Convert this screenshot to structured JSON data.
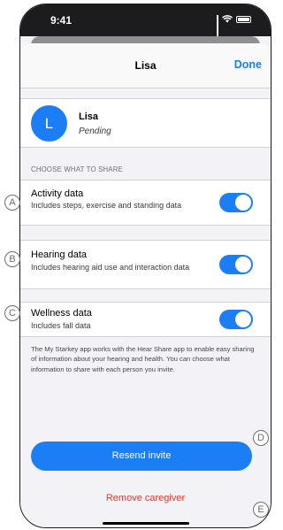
{
  "status_bar": {
    "time": "9:41",
    "icons": [
      "cellular-icon",
      "wifi-icon",
      "battery-icon"
    ]
  },
  "nav": {
    "title": "Lisa",
    "done_label": "Done"
  },
  "contact": {
    "initial": "L",
    "name": "Lisa",
    "status": "Pending"
  },
  "section_header": "CHOOSE WHAT TO SHARE",
  "share_options": [
    {
      "marker": "A",
      "title": "Activity data",
      "description": "Includes steps, exercise and standing data",
      "enabled": true
    },
    {
      "marker": "B",
      "title": "Hearing data",
      "description": "Includes hearing aid use and interaction data",
      "enabled": true
    },
    {
      "marker": "C",
      "title": "Wellness data",
      "description": "Includes fall data",
      "enabled": true
    }
  ],
  "footer_text": "The My Starkey app works with the Hear Share app to enable easy sharing of information about your hearing and health. You can choose what information to share with each person you invite.",
  "actions": {
    "resend_label": "Resend invite",
    "resend_marker": "D",
    "remove_label": "Remove caregiver",
    "remove_marker": "E"
  },
  "colors": {
    "accent": "#1b7ef5",
    "destructive": "#e8372d",
    "background": "#f2f2f7",
    "status_bar": "#1c1c1e"
  }
}
